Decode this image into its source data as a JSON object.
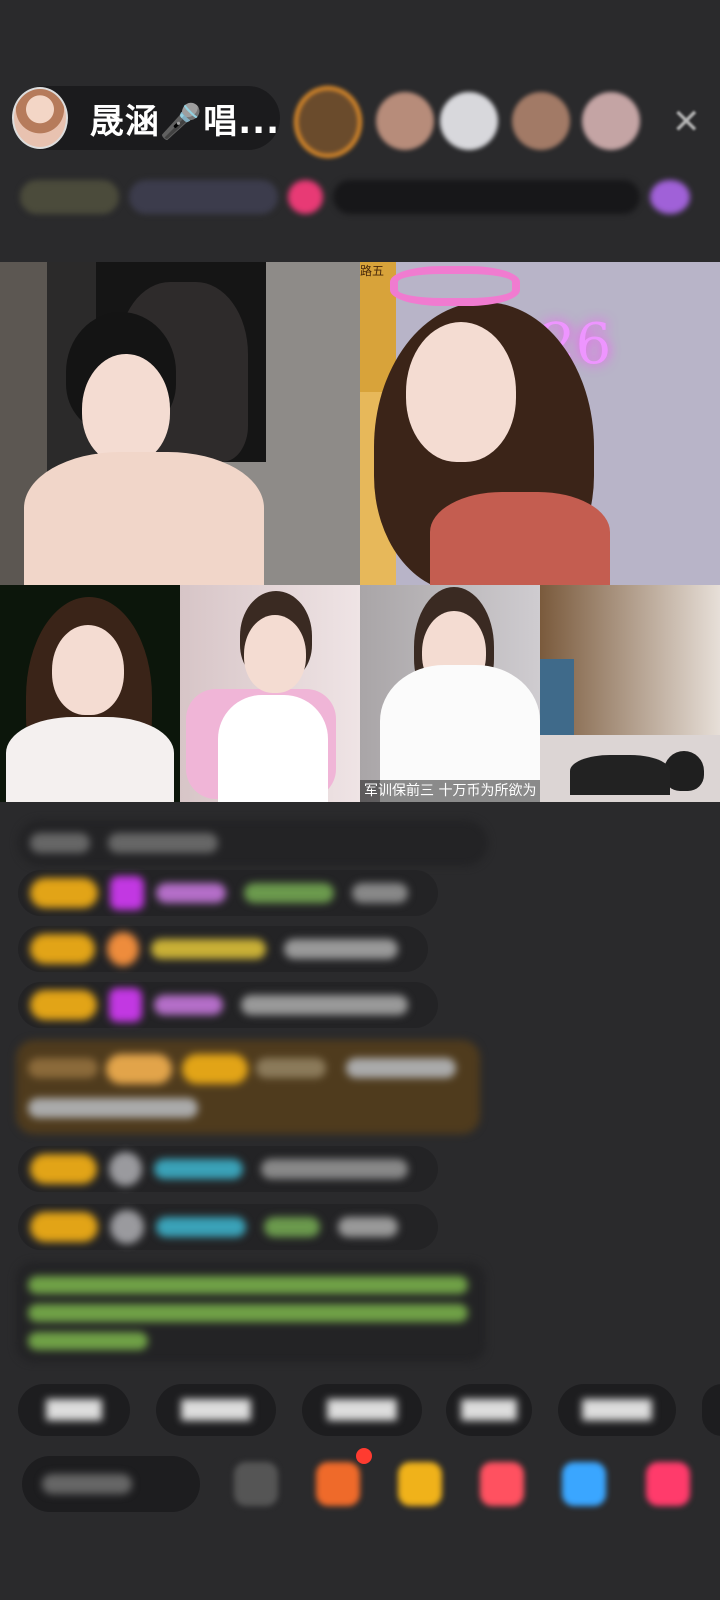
{
  "header": {
    "host_name": "晟涵🎤唱...",
    "viewers": [
      "viewer-1",
      "viewer-2",
      "viewer-3",
      "viewer-4",
      "viewer-5"
    ],
    "close_icon": "close-icon"
  },
  "video_grid": {
    "caption": "军训保前三  十万币为所欲为",
    "neon_text": "26",
    "poster_text": "路五"
  },
  "chat": {
    "messages": [
      "msg-1",
      "msg-2",
      "msg-3",
      "msg-4",
      "msg-5",
      "msg-6",
      "msg-7",
      "msg-8"
    ]
  },
  "quick_replies": [
    "quick-1",
    "quick-2",
    "quick-3",
    "quick-4",
    "quick-5"
  ],
  "bottom_bar": {
    "icons": [
      "comment-icon",
      "gift-box-icon",
      "treasure-icon",
      "game-icon",
      "chat-bubble-icon",
      "more-icon"
    ]
  },
  "colors": {
    "background": "#2a2a2c",
    "badge": "#e2a417",
    "pink_accent": "#f07bd0",
    "notification_dot": "#ff3b30"
  }
}
